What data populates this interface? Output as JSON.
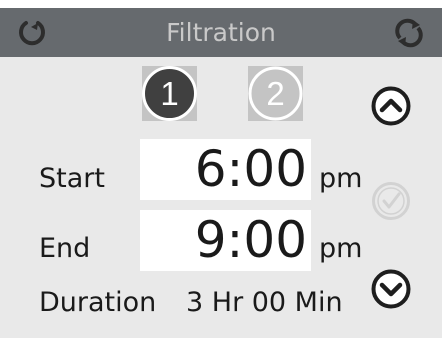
{
  "header": {
    "title": "Filtration",
    "left_icon": "power-cycle-icon",
    "right_icon": "refresh-arrows-icon"
  },
  "programs": [
    {
      "label": "1",
      "state": "selected"
    },
    {
      "label": "2",
      "state": "unselected"
    }
  ],
  "schedule": {
    "start_label": "Start",
    "start_time": "6:00",
    "start_unit": "pm",
    "end_label": "End",
    "end_time": "9:00",
    "end_unit": "pm",
    "duration_label": "Duration",
    "duration_value": "3 Hr 00 Min"
  },
  "side_buttons": {
    "up_icon": "chevron-up-circle-icon",
    "confirm_icon": "check-circle-icon",
    "confirm_state": "disabled",
    "down_icon": "chevron-down-circle-icon"
  },
  "colors": {
    "header_bg": "#666a6e",
    "header_text": "#c9c9c9",
    "panel_bg": "#e9e9e9",
    "selected_program": "#404040",
    "unselected_program": "#c4c4c4",
    "disabled_button": "#d2d2d2"
  }
}
